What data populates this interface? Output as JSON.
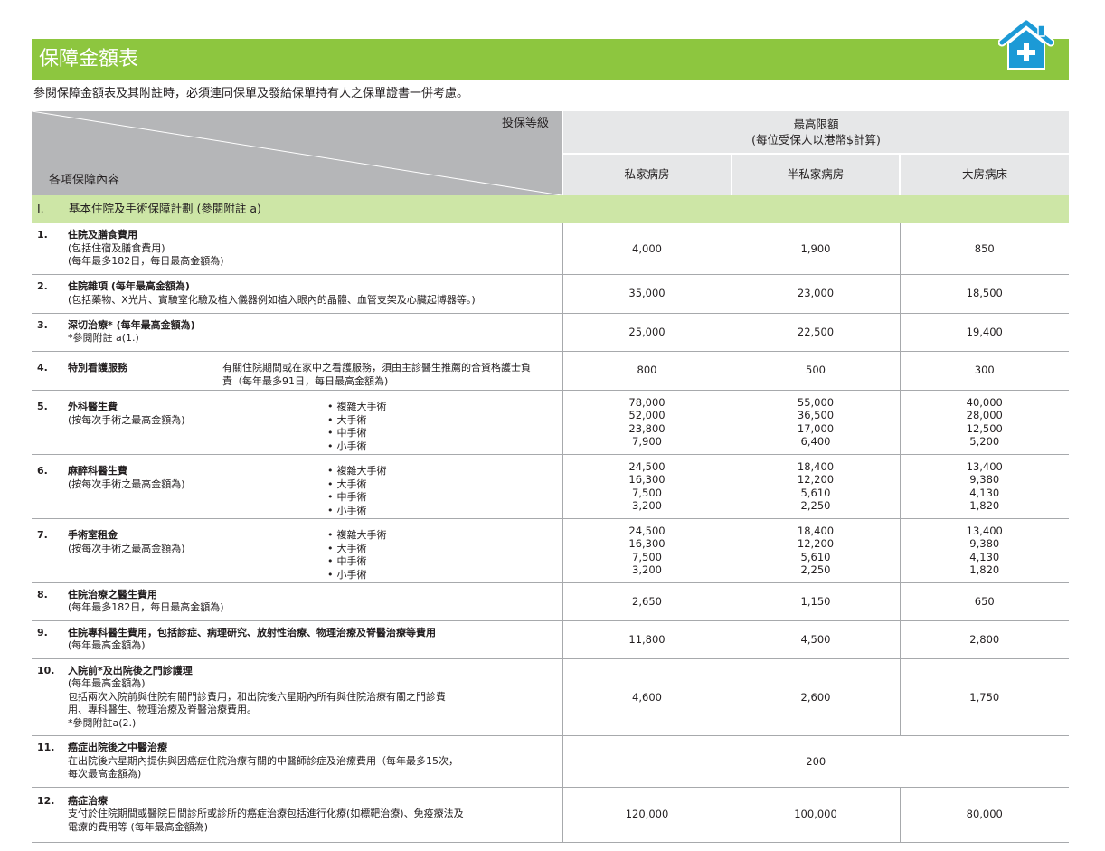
{
  "header": {
    "title": "保障金額表",
    "intro": "參閱保障金額表及其附註時，必須連同保單及發給保單持有人之保單證書一併考慮。",
    "brand_color": "#8dc63f",
    "icon": "home-plus-icon"
  },
  "table": {
    "tier_label": "投保等級",
    "items_label": "各項保障內容",
    "max_limit_line1": "最高限額",
    "max_limit_line2": "(每位受保人以港幣$計算)",
    "classes": [
      "私家病房",
      "半私家病房",
      "大房病床"
    ],
    "section": {
      "num": "I.",
      "label": "基本住院及手術保障計劃 (參閱附註 a)"
    },
    "rows": [
      {
        "num": "1.",
        "title": "住院及膳食費用",
        "lines": [
          "(包括住宿及膳食費用)",
          "(每年最多182日，每日最高金額為)"
        ],
        "values": [
          "4,000",
          "1,900",
          "850"
        ]
      },
      {
        "num": "2.",
        "title": "住院雜項 (每年最高金額為)",
        "lines": [
          "(包括藥物、X光片、實驗室化驗及植入儀器例如植入眼內的晶體、血管支架及心臟起博器等。)"
        ],
        "values": [
          "35,000",
          "23,000",
          "18,500"
        ]
      },
      {
        "num": "3.",
        "title": "深切治療* (每年最高金額為)",
        "lines": [
          "*參閱附註 a(1.)"
        ],
        "values": [
          "25,000",
          "22,500",
          "19,400"
        ]
      },
      {
        "num": "4.",
        "title": "特別看護服務",
        "note": "有關住院期間或在家中之看護服務，須由主診醫生推薦的合資格護士負責（每年最多91日，每日最高金額為)",
        "values": [
          "800",
          "500",
          "300"
        ]
      },
      {
        "num": "5.",
        "title": "外科醫生費",
        "lines": [
          "(按每次手術之最高金額為)"
        ],
        "bullets": [
          "複雜大手術",
          "大手術",
          "中手術",
          "小手術"
        ],
        "values": [
          [
            "78,000",
            "52,000",
            "23,800",
            "7,900"
          ],
          [
            "55,000",
            "36,500",
            "17,000",
            "6,400"
          ],
          [
            "40,000",
            "28,000",
            "12,500",
            "5,200"
          ]
        ]
      },
      {
        "num": "6.",
        "title": "麻醉科醫生費",
        "lines": [
          "(按每次手術之最高金額為)"
        ],
        "bullets": [
          "複雜大手術",
          "大手術",
          "中手術",
          "小手術"
        ],
        "values": [
          [
            "24,500",
            "16,300",
            "7,500",
            "3,200"
          ],
          [
            "18,400",
            "12,200",
            "5,610",
            "2,250"
          ],
          [
            "13,400",
            "9,380",
            "4,130",
            "1,820"
          ]
        ]
      },
      {
        "num": "7.",
        "title": "手術室租金",
        "lines": [
          "(按每次手術之最高金額為)"
        ],
        "bullets": [
          "複雜大手術",
          "大手術",
          "中手術",
          "小手術"
        ],
        "values": [
          [
            "24,500",
            "16,300",
            "7,500",
            "3,200"
          ],
          [
            "18,400",
            "12,200",
            "5,610",
            "2,250"
          ],
          [
            "13,400",
            "9,380",
            "4,130",
            "1,820"
          ]
        ]
      },
      {
        "num": "8.",
        "title": "住院治療之醫生費用",
        "lines": [
          "(每年最多182日，每日最高金額為)"
        ],
        "values": [
          "2,650",
          "1,150",
          "650"
        ]
      },
      {
        "num": "9.",
        "title": "住院專科醫生費用，包括診症、病理研究、放射性治療、物理治療及脊醫治療等費用",
        "lines": [
          "(每年最高金額為)"
        ],
        "values": [
          "11,800",
          "4,500",
          "2,800"
        ]
      },
      {
        "num": "10.",
        "title": "入院前*及出院後之門診護理",
        "lines": [
          "(每年最高金額為)",
          "包括兩次入院前與住院有關門診費用，和出院後六星期內所有與住院治療有關之門診費",
          "用、專科醫生、物理治療及脊醫治療費用。",
          "*參閱附註a(2.)"
        ],
        "values": [
          "4,600",
          "2,600",
          "1,750"
        ]
      },
      {
        "num": "11.",
        "title": "癌症出院後之中醫治療",
        "lines": [
          "在出院後六星期內提供與因癌症住院治療有關的中醫師診症及治療費用（每年最多15次，",
          "每次最高金額為)"
        ],
        "value_all": "200"
      },
      {
        "num": "12.",
        "title": "癌症治療",
        "lines": [
          "支付於住院期間或醫院日間診所或診所的癌症治療包括進行化療(如標靶治療)、免疫療法及",
          "電療的費用等 (每年最高金額為)"
        ],
        "values": [
          "120,000",
          "100,000",
          "80,000"
        ]
      }
    ]
  }
}
